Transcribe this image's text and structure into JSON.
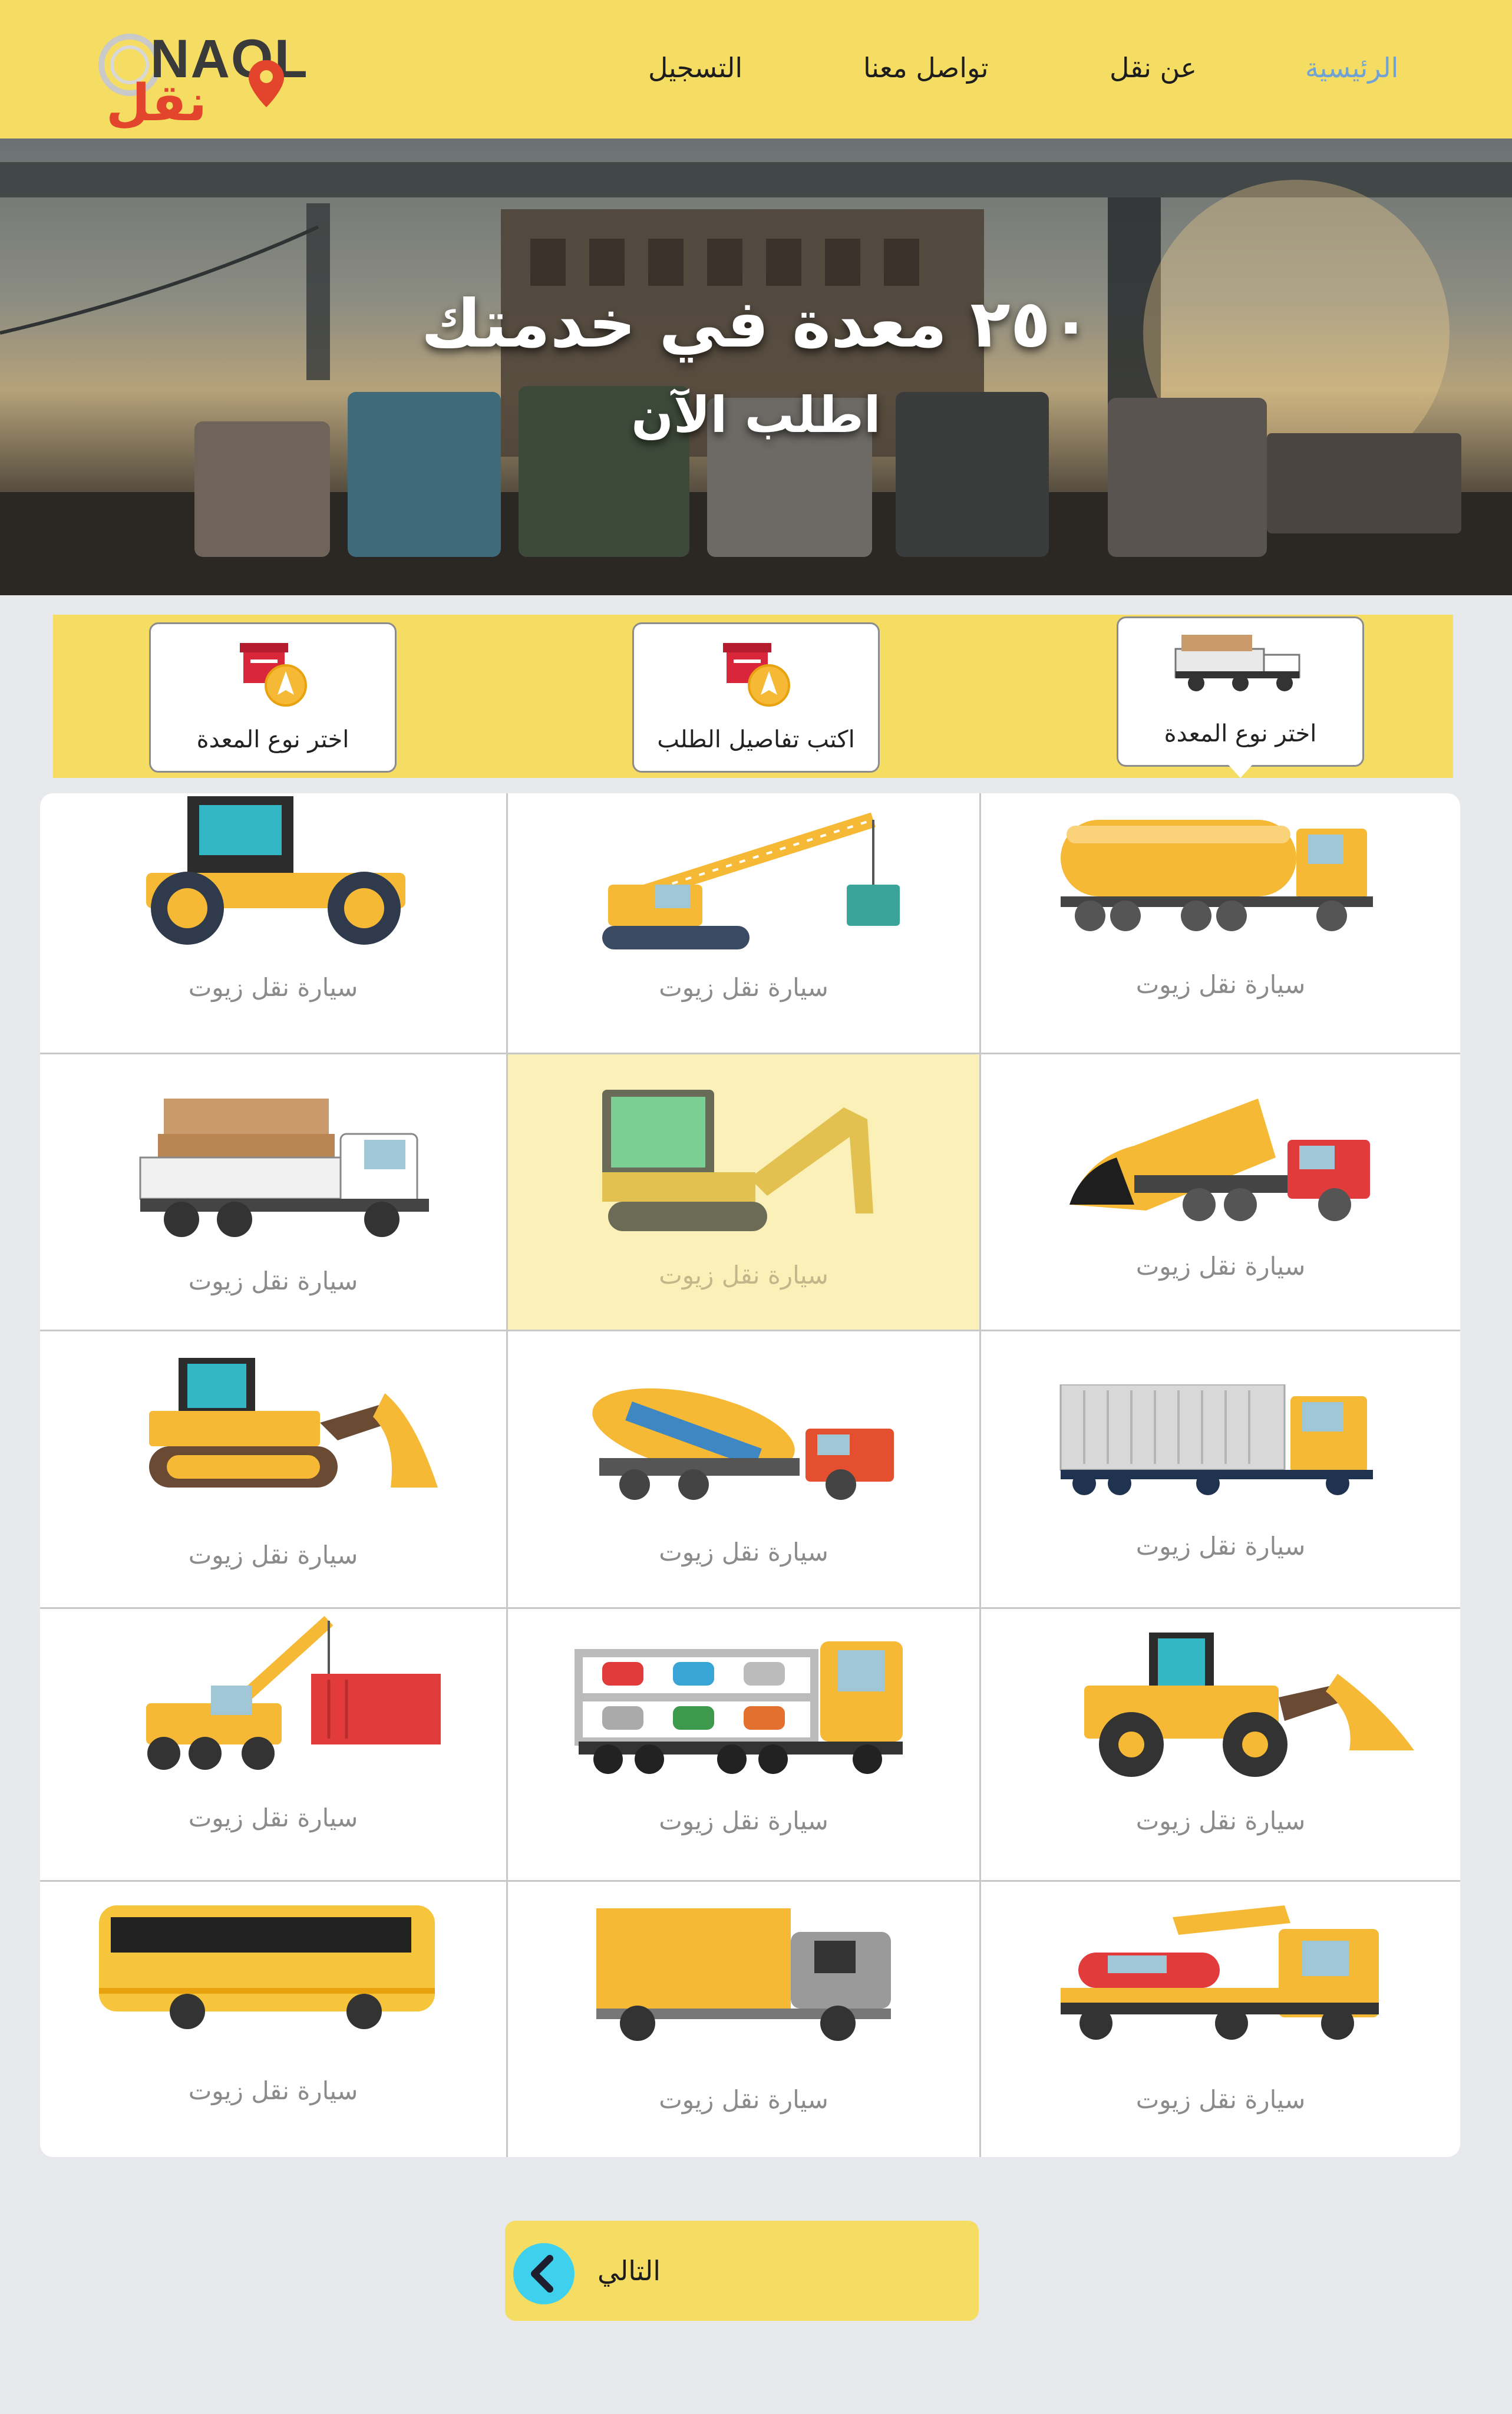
{
  "nav": {
    "logo_latin": "NAQL",
    "logo_arabic": "نقل",
    "items": [
      {
        "label": "الرئيسية",
        "active": true
      },
      {
        "label": "عن نقل",
        "active": false
      },
      {
        "label": "تواصل معنا",
        "active": false
      },
      {
        "label": "التسجيل",
        "active": false
      }
    ]
  },
  "hero": {
    "title": "٢٥٠ معدة في خدمتك",
    "subtitle": "اطلب الآن"
  },
  "steps": [
    {
      "label": "اختر نوع المعدة",
      "icon": "truck-icon",
      "active": true
    },
    {
      "label": "اكتب تفاصيل الطلب",
      "icon": "box-rocket-icon",
      "active": false
    },
    {
      "label": "اختر نوع المعدة",
      "icon": "box-rocket-icon",
      "active": false
    }
  ],
  "vehicles": [
    {
      "label": "سيارة نقل زيوت",
      "icon": "tanker-truck-icon"
    },
    {
      "label": "سيارة نقل زيوت",
      "icon": "crawler-crane-icon"
    },
    {
      "label": "سيارة نقل زيوت",
      "icon": "road-roller-icon"
    },
    {
      "label": "سيارة نقل زيوت",
      "icon": "dump-truck-icon"
    },
    {
      "label": "سيارة نقل زيوت",
      "icon": "excavator-icon",
      "selected": true
    },
    {
      "label": "سيارة نقل زيوت",
      "icon": "cargo-truck-icon"
    },
    {
      "label": "سيارة نقل زيوت",
      "icon": "container-truck-icon"
    },
    {
      "label": "سيارة نقل زيوت",
      "icon": "cement-mixer-icon"
    },
    {
      "label": "سيارة نقل زيوت",
      "icon": "bulldozer-icon"
    },
    {
      "label": "سيارة نقل زيوت",
      "icon": "wheel-loader-icon"
    },
    {
      "label": "سيارة نقل زيوت",
      "icon": "car-carrier-icon"
    },
    {
      "label": "سيارة نقل زيوت",
      "icon": "mobile-crane-icon"
    },
    {
      "label": "سيارة نقل زيوت",
      "icon": "tow-truck-icon"
    },
    {
      "label": "سيارة نقل زيوت",
      "icon": "box-van-icon"
    },
    {
      "label": "سيارة نقل زيوت",
      "icon": "bus-icon"
    }
  ],
  "next_button": {
    "label": "التالي",
    "icon": "chevron-left-icon"
  },
  "colors": {
    "accent": "#f5dc62",
    "active_nav": "#6fa3d6",
    "machine": "#f6b935",
    "arrow_circle": "#3fd0ee"
  }
}
